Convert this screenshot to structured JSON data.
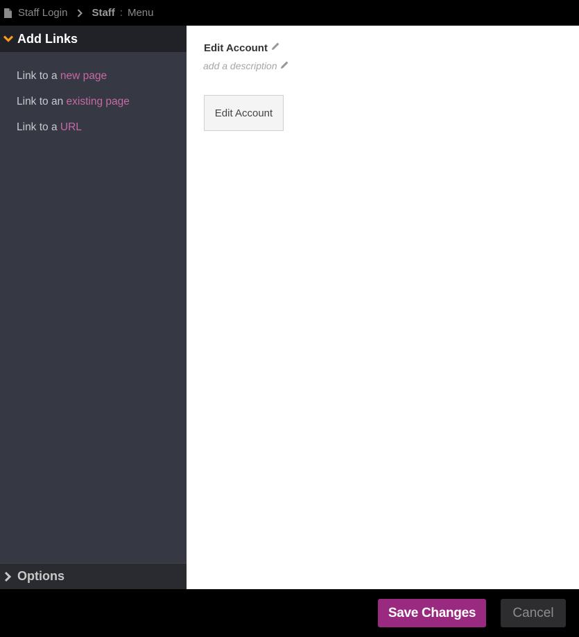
{
  "breadcrumb": {
    "page": "Staff Login",
    "section": "Staff",
    "separator": ":",
    "subsection": "Menu"
  },
  "sidebar": {
    "add_links_header": "Add Links",
    "links": [
      {
        "prefix": "Link to a ",
        "highlight": "new page"
      },
      {
        "prefix": "Link to an ",
        "highlight": "existing page"
      },
      {
        "prefix": "Link to a ",
        "highlight": "URL"
      }
    ],
    "options_header": "Options"
  },
  "main": {
    "title": "Edit Account",
    "description_placeholder": "add a description",
    "menu_button_label": "Edit Account"
  },
  "footer": {
    "save_label": "Save Changes",
    "cancel_label": "Cancel"
  },
  "colors": {
    "accent": "#9a2a80",
    "link_highlight": "#c56ba6",
    "chevron_accent": "#f39c1d",
    "sidebar_bg": "#363843"
  }
}
